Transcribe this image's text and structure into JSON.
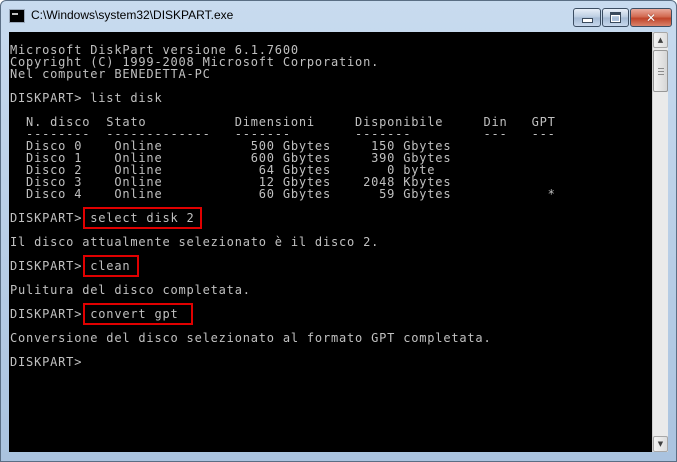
{
  "window": {
    "title": "C:\\Windows\\system32\\DISKPART.exe",
    "icon": "console-icon"
  },
  "controls": {
    "minimize": "minimize-icon",
    "maximize": "maximize-icon",
    "close": "close-icon",
    "close_glyph": "✕"
  },
  "console": {
    "lines": [
      "Microsoft DiskPart versione 6.1.7600",
      "Copyright (C) 1999-2008 Microsoft Corporation.",
      "Nel computer BENEDETTA-PC",
      "",
      "DISKPART> list disk",
      "",
      "  N. disco  Stato           Dimensioni     Disponibile     Din   GPT",
      "  --------  -------------   -------        -------         ---   ---",
      "  Disco 0    Online           500 Gbytes     150 Gbytes",
      "  Disco 1    Online           600 Gbytes     390 Gbytes",
      "  Disco 2    Online            64 Gbytes       0 byte",
      "  Disco 3    Online            12 Gbytes    2048 Kbytes",
      "  Disco 4    Online            60 Gbytes      59 Gbytes            *",
      "",
      "DISKPART> select disk 2",
      "",
      "Il disco attualmente selezionato è il disco 2.",
      "",
      "DISKPART> clean",
      "",
      "Pulitura del disco completata.",
      "",
      "DISKPART> convert gpt",
      "",
      "Conversione del disco selezionato al formato GPT completata.",
      "",
      "DISKPART>"
    ]
  },
  "scrollbar": {
    "up_arrow": "▲",
    "down_arrow": "▼"
  },
  "colors": {
    "console_bg": "#000000",
    "console_text": "#c0c0c0",
    "highlight": "#e00000"
  }
}
